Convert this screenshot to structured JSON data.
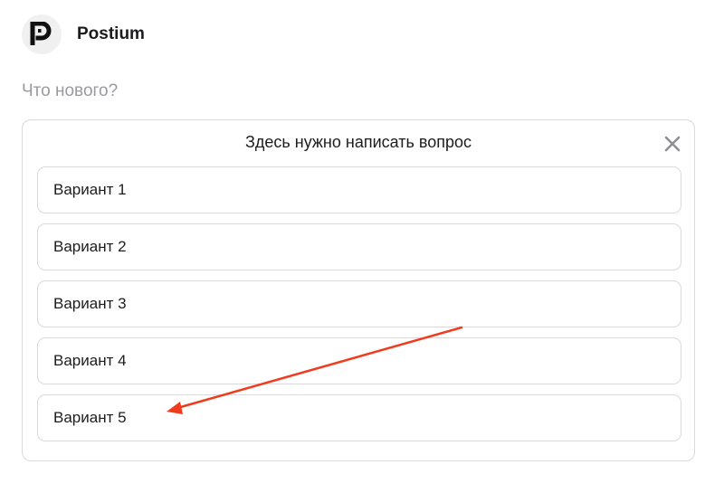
{
  "header": {
    "account_name": "Postium",
    "logo_icon": "postium-logo-icon"
  },
  "compose": {
    "placeholder": "Что нового?"
  },
  "poll": {
    "question": "Здесь нужно написать вопрос",
    "close_icon": "close-icon",
    "options": [
      {
        "label": "Вариант 1"
      },
      {
        "label": "Вариант 2"
      },
      {
        "label": "Вариант 3"
      },
      {
        "label": "Вариант 4"
      },
      {
        "label": "Вариант 5"
      }
    ]
  },
  "annotation": {
    "arrow_color": "#f03c1e",
    "points_to": "Вариант 5"
  }
}
